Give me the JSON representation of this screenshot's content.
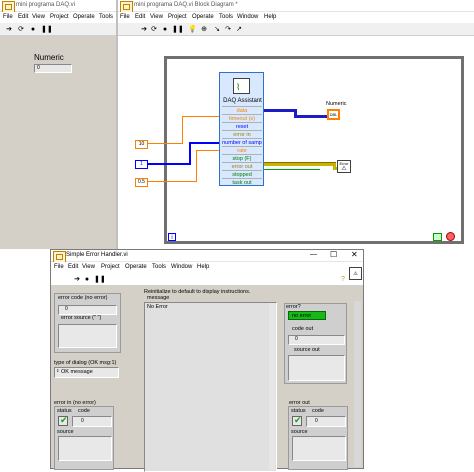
{
  "front_panel": {
    "title": "mini programa DAQ.vi",
    "menus": [
      "File",
      "Edit",
      "View",
      "Project",
      "Operate",
      "Tools"
    ],
    "numeric_label": "Numeric",
    "numeric_value": "0"
  },
  "block_diagram": {
    "title": "mini programa DAQ.vi Block Diagram *",
    "menus": [
      "File",
      "Edit",
      "View",
      "Project",
      "Operate",
      "Tools",
      "Window",
      "Help"
    ],
    "daq_node": {
      "title": "DAQ Assistant",
      "terminals": [
        "data",
        "timeout (s)",
        "reset",
        "error in",
        "number of samp",
        "rate",
        "stop (F)",
        "error out",
        "stopped",
        "task out"
      ]
    },
    "constants": {
      "timeout": "10",
      "number": "1",
      "rate": "0.5"
    },
    "numeric_indicator_label": "Numeric",
    "numeric_indicator_text": "DBL",
    "loop_iteration": "i",
    "stop_terminal": "",
    "error_handler_sub_label": "Error"
  },
  "error_handler": {
    "title": "Simple Error Handler.vi",
    "menus": [
      "File",
      "Edit",
      "View",
      "Project",
      "Operate",
      "Tools",
      "Window",
      "Help"
    ],
    "error_code_label": "error code (no error)",
    "error_code_value": "0",
    "error_source_label": "error source (\" \")",
    "type_of_dialog_label": "type of dialog (OK msg:1)",
    "type_of_dialog_value": "OK message",
    "message_hint": "Reinitialize to default to display instructions.",
    "message_label": "message",
    "message_value": "No Error",
    "error_label": "error?",
    "error_value": "no error",
    "code_out_label": "code out",
    "code_out_value": "0",
    "source_out_label": "source out",
    "error_in": {
      "label": "error in (no error)",
      "status_label": "status",
      "code_label": "code",
      "code_value": "0",
      "source_label": "source"
    },
    "error_out": {
      "label": "error out",
      "status_label": "status",
      "code_label": "code",
      "code_value": "0",
      "source_label": "source"
    }
  },
  "colors": {
    "panel_grey": "#d4d0c8",
    "wire_orange": "#ff8000",
    "wire_blue": "#0000ff",
    "wire_dbl": "#ff8000",
    "wire_bool": "#00a000",
    "wire_error": "#c8b400",
    "loop_border": "#707070",
    "daq_blue": "#2f6fd0"
  }
}
